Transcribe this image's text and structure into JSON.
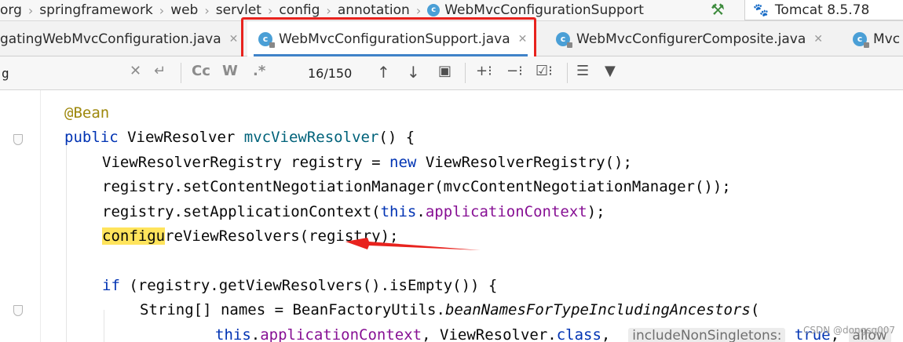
{
  "breadcrumb": {
    "items": [
      "org",
      "springframework",
      "web",
      "servlet",
      "config",
      "annotation"
    ],
    "current": "WebMvcConfigurationSupport"
  },
  "run_config": {
    "label": "Tomcat 8.5.78"
  },
  "tabs": [
    {
      "label": "gatingWebMvcConfiguration.java",
      "active": false
    },
    {
      "label": "WebMvcConfigurationSupport.java",
      "active": true
    },
    {
      "label": "WebMvcConfigurerComposite.java",
      "active": false
    },
    {
      "label": "Mvc",
      "active": false
    }
  ],
  "find": {
    "query": "g",
    "match_case": "Cc",
    "words": "W",
    "regex": ".*",
    "count": "16/150"
  },
  "code": {
    "l1": {
      "ann": "@Bean"
    },
    "l2": {
      "kw": "public",
      "t1": " ViewResolver ",
      "fn": "mvcViewResolver",
      "t2": "() {"
    },
    "l3": {
      "t1": "ViewResolverRegistry registry = ",
      "kw": "new",
      "t2": " ViewResolverRegistry();"
    },
    "l4": {
      "t1": "registry.setContentNegotiationManager(mvcContentNegotiationManager());"
    },
    "l5": {
      "t1": "registry.setApplicationContext(",
      "kw": "this",
      "dot": ".",
      "field": "applicationContext",
      "t2": ");"
    },
    "l6": {
      "hl": "configu",
      "t1": "reViewResolvers(registry);"
    },
    "l7": {
      "kw": "if",
      "t1": " (registry.getViewResolvers().isEmpty()) {"
    },
    "l8": {
      "t1": "String[] names = BeanFactoryUtils.",
      "st": "beanNamesForTypeIncludingAncestors",
      "t2": "("
    },
    "l9": {
      "kw": "this",
      "dot": ".",
      "field": "applicationContext",
      "t1": ", ViewResolver.",
      "kw2": "class",
      "t2": ",  ",
      "hint": "includeNonSingletons:",
      "kw3": " true",
      "t3": ", ",
      "hint2": "allow"
    }
  },
  "watermark": "CSDN @dongsq007",
  "colors": {
    "highlight_box": "#e8231e",
    "arrow": "#e8231e",
    "accent": "#4083c9"
  }
}
